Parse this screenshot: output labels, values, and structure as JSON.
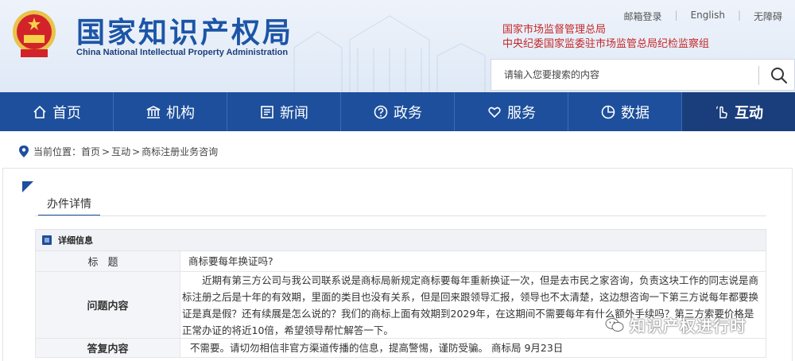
{
  "header": {
    "title_cn": "国家知识产权局",
    "title_en": "China National Intellectual Property Administration",
    "links": [
      "邮箱登录",
      "English",
      "无障碍"
    ],
    "org_lines": [
      "国家市场监督管理总局",
      "中央纪委国家监委驻市场监管总局纪检监察组"
    ],
    "search_placeholder": "请输入您要搜索的内容"
  },
  "nav": {
    "items": [
      {
        "label": "首页",
        "icon": "home-icon"
      },
      {
        "label": "机构",
        "icon": "institution-icon"
      },
      {
        "label": "新闻",
        "icon": "news-icon"
      },
      {
        "label": "政务",
        "icon": "question-icon"
      },
      {
        "label": "服务",
        "icon": "heart-hand-icon"
      },
      {
        "label": "数据",
        "icon": "pie-chart-icon"
      },
      {
        "label": "互动",
        "icon": "hand-pointer-icon"
      }
    ],
    "active_index": 6
  },
  "breadcrumb": {
    "prefix": "当前位置：",
    "items": [
      "首页",
      "互动",
      "商标注册业务咨询"
    ],
    "sep": ">"
  },
  "content": {
    "tab_label": "办件详情",
    "section_title": "详细信息",
    "rows": [
      {
        "label": "标题",
        "value": "商标要每年换证吗?"
      },
      {
        "label": "问题内容",
        "value": "近期有第三方公司与我公司联系说是商标局新规定商标要每年重新换证一次，但是去市民之家咨询，负责这块工作的同志说是商标注册之后是十年的有效期，里面的类目也没有关系，但是回来跟领导汇报，领导也不太清楚，这边想咨询一下第三方说每年都要换证是真是假？还有续展是怎么说的？我们的商标上面有效期到2029年，在这期间不需要每年有什么额外手续吗？第三方索要价格是正常办证的将近10倍，希望领导帮忙解答一下。"
      },
      {
        "label": "答复内容",
        "value": "不需要。请切勿相信非官方渠道传播的信息，提高警惕，谨防受骗。 商标局 9月23日"
      }
    ]
  },
  "watermark": "知识产权进行时",
  "colors": {
    "nav_bg": "#1d4f9c",
    "brand_blue": "#1c55a6",
    "org_red": "#c4292a"
  }
}
